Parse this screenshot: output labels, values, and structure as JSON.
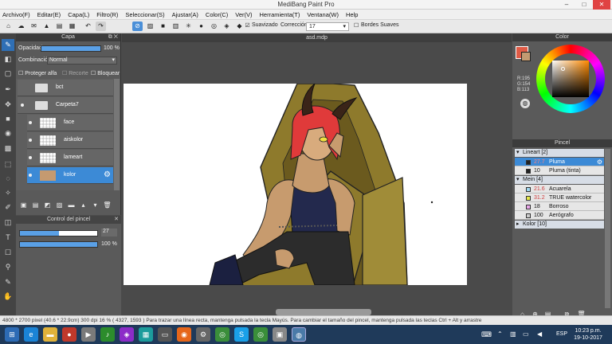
{
  "window": {
    "title": "MediBang Paint Pro",
    "min": "–",
    "max": "□",
    "close": "✕"
  },
  "menu": [
    "Archivo(F)",
    "Editar(E)",
    "Capa(L)",
    "Filtro(R)",
    "Seleccionar(S)",
    "Ajustar(A)",
    "Color(C)",
    "Ver(V)",
    "Herramienta(T)",
    "Ventana(W)",
    "Help"
  ],
  "toolbar": {
    "smooth_label": "Suavizado",
    "correction_label": "Corrección",
    "correction_value": "17",
    "soft_edges_label": "Bordes Suaves"
  },
  "canvas": {
    "doc_title": "asd.mdp"
  },
  "layer_panel": {
    "title": "Capa",
    "opacity_label": "Opacidad",
    "opacity_value": "100 %",
    "opacity_fill": 1.0,
    "blend_label": "Combinación",
    "blend_value": "Normal",
    "protect_alpha": "Proteger alfa",
    "clip": "Recorte",
    "lock": "Bloquear",
    "layers": [
      {
        "name": "bct",
        "type": "folder",
        "visible": false,
        "selected": false
      },
      {
        "name": "Carpeta7",
        "type": "folder",
        "visible": true,
        "selected": false
      },
      {
        "name": "face",
        "type": "layer",
        "visible": true,
        "selected": false
      },
      {
        "name": "aiskolor",
        "type": "layer",
        "visible": true,
        "selected": false
      },
      {
        "name": "lameart",
        "type": "layer",
        "visible": true,
        "selected": false
      },
      {
        "name": "kolor",
        "type": "layer",
        "visible": true,
        "selected": true
      }
    ]
  },
  "brush_control": {
    "title": "Control del pincel",
    "size_value": "27",
    "size_fill": 0.5,
    "opacity_value": "100 %",
    "opacity_fill": 1.0
  },
  "color_panel": {
    "title": "Color",
    "r": "R:195",
    "g": "G:154",
    "b": "B:113",
    "primary": "#c39a71"
  },
  "pincel_panel": {
    "title": "Pincel",
    "groups": [
      {
        "name": "Lineart [2]",
        "expanded": true,
        "items": [
          {
            "size": "27.7",
            "name": "Pluma",
            "selected": true,
            "swatch": "#222222"
          },
          {
            "size": "10",
            "name": "Pluma (tinta)",
            "selected": false,
            "swatch": "#222222"
          }
        ]
      },
      {
        "name": "Mein [4]",
        "expanded": true,
        "items": [
          {
            "size": "21.6",
            "name": "Acuarela",
            "selected": false,
            "swatch": "#9fd7f0"
          },
          {
            "size": "31.2",
            "name": "TRUE watercolor",
            "selected": false,
            "swatch": "#e6e84a"
          },
          {
            "size": "18",
            "name": "Borroso",
            "selected": false,
            "swatch": "#e9a6e9"
          },
          {
            "size": "100",
            "name": "Aerógrafo",
            "selected": false,
            "swatch": "#cccccc"
          }
        ]
      },
      {
        "name": "Kolor [10]",
        "expanded": false,
        "items": []
      }
    ]
  },
  "status": {
    "text": "4800 * 2700 pixel  (40.6 * 22.9cm)  300 dpi  16 %  ( 4327, 1593 )  Para trazar una línea recta, mantenga pulsada la tecla Mayús. Para cambiar el tamaño del pincel, mantenga pulsada las teclas Ctrl + Alt y arrastre"
  },
  "taskbar": {
    "lang": "ESP",
    "time": "10:23 p.m.",
    "date": "19-10-2017"
  }
}
